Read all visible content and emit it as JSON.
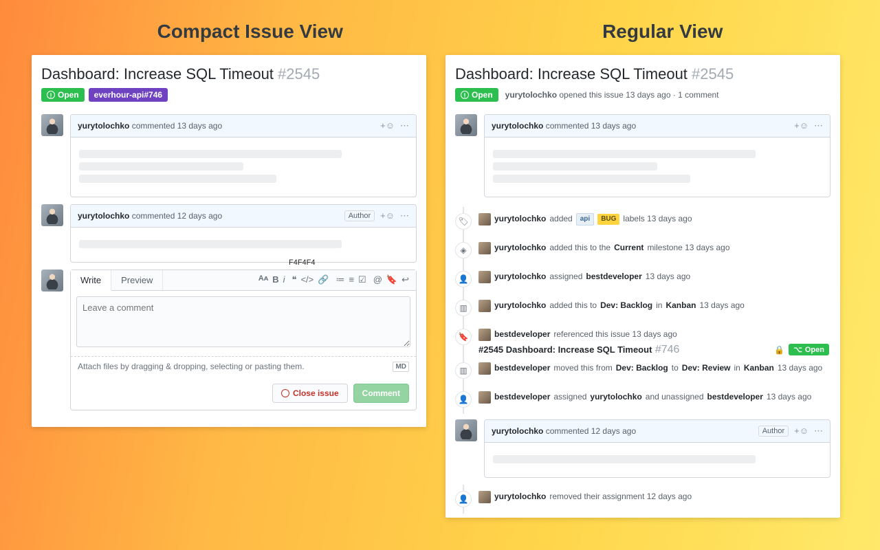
{
  "headings": {
    "left": "Compact Issue View",
    "right": "Regular View"
  },
  "issue": {
    "title_text": "Dashboard: Increase SQL Timeout",
    "number": "#2545",
    "open_label": "Open",
    "api_badge": "everhour-api#746",
    "meta_user": "yurytolochko",
    "meta_text": "opened this issue 13 days ago · 1 comment"
  },
  "comments": {
    "c1_user": "yurytolochko",
    "c1_text": "commented 13 days ago",
    "c2_user": "yurytolochko",
    "c2_text": "commented 12 days ago",
    "author_label": "Author",
    "react_glyph": "+☺",
    "dots_glyph": "⋯"
  },
  "editor": {
    "write": "Write",
    "preview": "Preview",
    "placeholder": "Leave a comment",
    "attach": "Attach files by dragging & dropping, selecting or pasting them.",
    "close_btn": "Close issue",
    "comment_btn": "Comment",
    "md": "MD",
    "hex_hint": "F4F4F4"
  },
  "timeline": {
    "t1_user": "yurytolochko",
    "t1_a": "added",
    "t1_lab_api": "api",
    "t1_lab_bug": "BUG",
    "t1_b": "labels 13 days ago",
    "t2_user": "yurytolochko",
    "t2_a": "added this to the",
    "t2_b": "Current",
    "t2_c": "milestone 13 days ago",
    "t3_user": "yurytolochko",
    "t3_a": "assigned",
    "t3_b": "bestdeveloper",
    "t3_c": "13 days ago",
    "t4_user": "yurytolochko",
    "t4_a": "added this to",
    "t4_b": "Dev: Backlog",
    "t4_c": "in",
    "t4_d": "Kanban",
    "t4_e": "13 days ago",
    "t5_user": "bestdeveloper",
    "t5_a": "referenced this issue 13 days ago",
    "t5_ref": "#2545 Dashboard: Increase SQL Timeout",
    "t5_refnum": "#746",
    "t5_open": "Open",
    "t6_user": "bestdeveloper",
    "t6_a": "moved this from",
    "t6_b": "Dev: Backlog",
    "t6_c": "to",
    "t6_d": "Dev: Review",
    "t6_e": "in",
    "t6_f": "Kanban",
    "t6_g": "13 days ago",
    "t7_user": "bestdeveloper",
    "t7_a": "assigned",
    "t7_b": "yurytolochko",
    "t7_c": "and unassigned",
    "t7_d": "bestdeveloper",
    "t7_e": "13 days ago",
    "c3_user": "yurytolochko",
    "c3_text": "commented 12 days ago",
    "t8_user": "yurytolochko",
    "t8_a": "removed their assignment 12 days ago"
  }
}
